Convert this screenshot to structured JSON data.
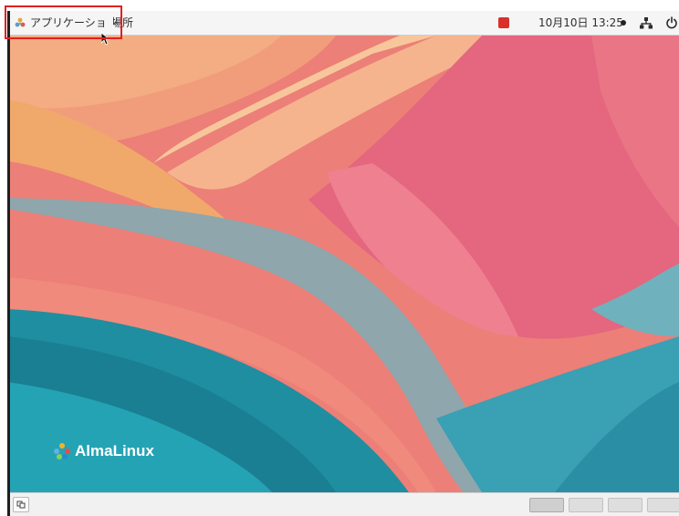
{
  "top_panel": {
    "applications_label": "アプリケーション",
    "places_label": "場所",
    "clock": "10月10日 13:25"
  },
  "desktop": {
    "brand_name": "AlmaLinux"
  },
  "bottom_panel": {
    "workspaces": [
      {
        "active": true
      },
      {
        "active": false
      },
      {
        "active": false
      },
      {
        "active": false
      }
    ]
  },
  "colors": {
    "highlight": "#e12121",
    "panel": "#f5f5f5",
    "wallpaper_coral": "#f07f73",
    "wallpaper_pink": "#e46a83",
    "wallpaper_peach": "#f3b98d",
    "wallpaper_teal": "#1f8ea0"
  }
}
